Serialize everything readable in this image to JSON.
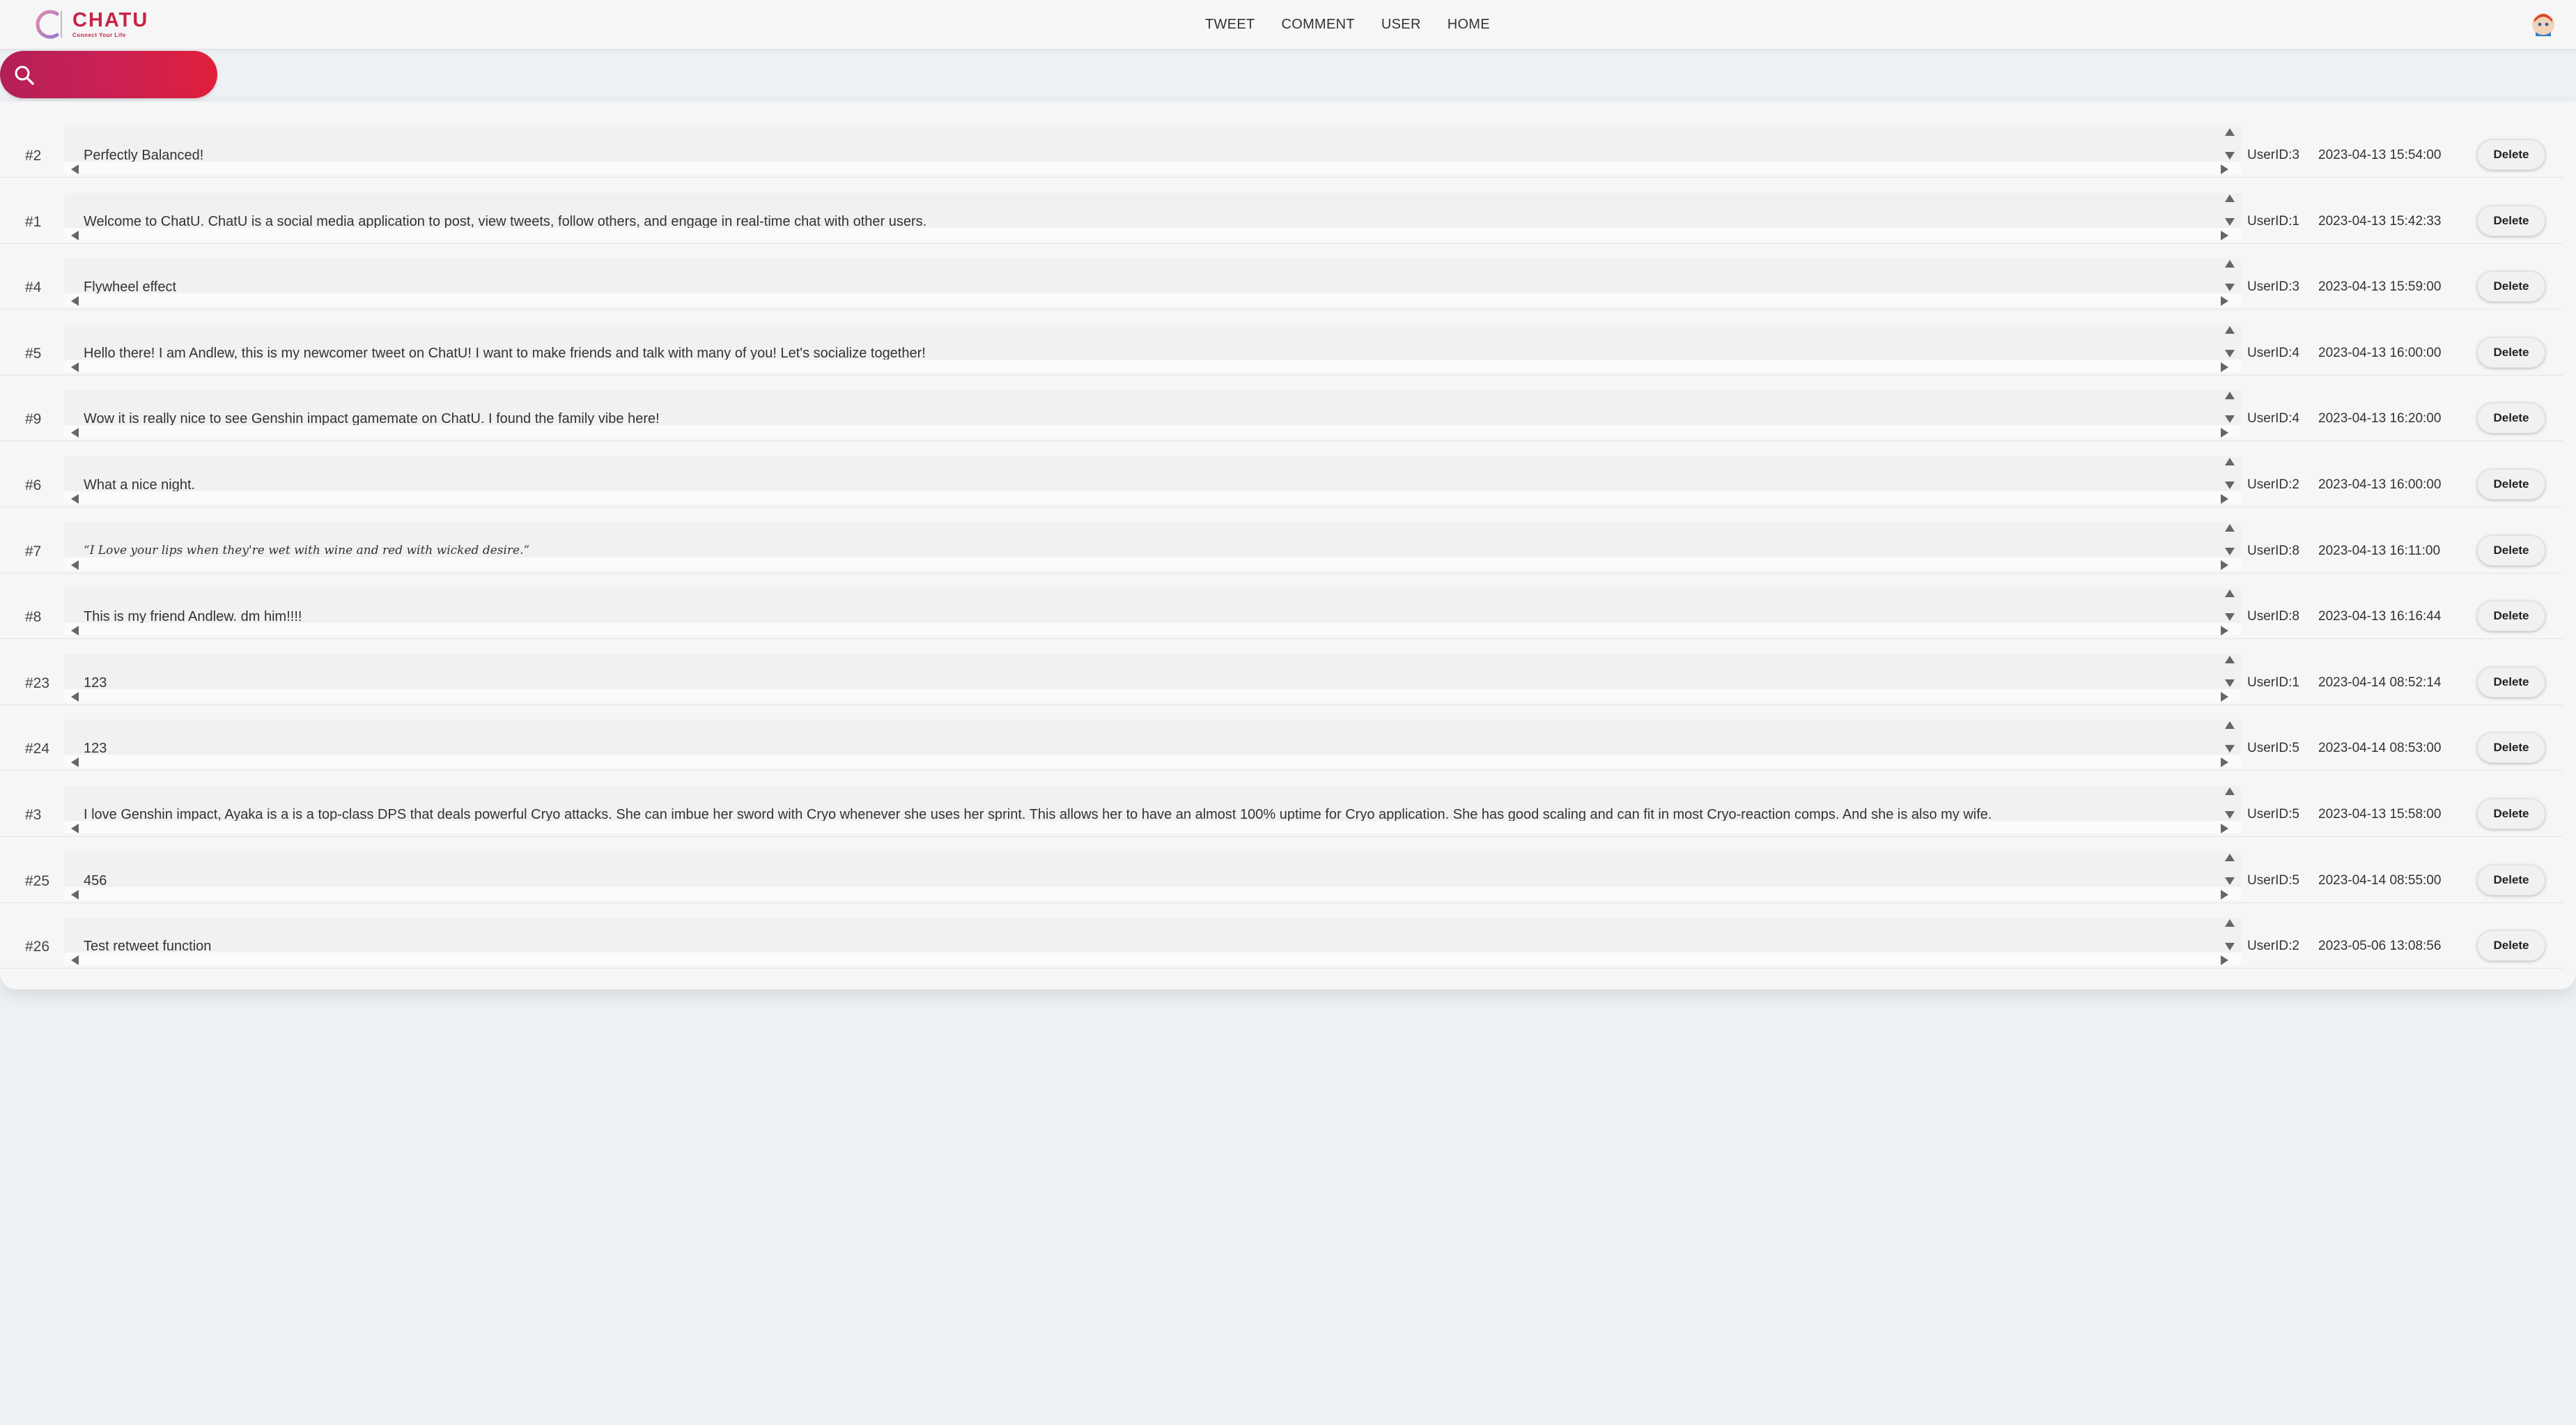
{
  "app": {
    "brand": "CHATU",
    "tagline": "Connect Your Life"
  },
  "nav": {
    "items": [
      {
        "label": "TWEET",
        "name": "nav-tweet"
      },
      {
        "label": "COMMENT",
        "name": "nav-comment"
      },
      {
        "label": "USER",
        "name": "nav-user"
      },
      {
        "label": "HOME",
        "name": "nav-home"
      }
    ]
  },
  "search": {
    "placeholder": "",
    "value": "",
    "icon": "search-icon"
  },
  "colors": {
    "brand": "#c72346",
    "search_gradient_start": "#b31f57",
    "search_gradient_end": "#e01f3a",
    "page_bg": "#eef1f4"
  },
  "tweets": {
    "delete_label": "Delete",
    "rows": [
      {
        "id": "#2",
        "content": "Perfectly Balanced!",
        "user": "UserID:3",
        "time": "2023-04-13 15:54:00",
        "italic": false
      },
      {
        "id": "#1",
        "content": "Welcome to ChatU. ChatU is a social media application to post, view tweets, follow others, and engage in real-time chat with other users.",
        "user": "UserID:1",
        "time": "2023-04-13 15:42:33",
        "italic": false
      },
      {
        "id": "#4",
        "content": "Flywheel effect",
        "user": "UserID:3",
        "time": "2023-04-13 15:59:00",
        "italic": false
      },
      {
        "id": "#5",
        "content": "Hello there! I am Andlew, this is my newcomer tweet on ChatU! I want to make friends and talk with many of you! Let's socialize together!",
        "user": "UserID:4",
        "time": "2023-04-13 16:00:00",
        "italic": false
      },
      {
        "id": "#9",
        "content": "Wow it is really nice to see Genshin impact gamemate on ChatU. I found the family vibe here!",
        "user": "UserID:4",
        "time": "2023-04-13 16:20:00",
        "italic": false
      },
      {
        "id": "#6",
        "content": "What a nice night.",
        "user": "UserID:2",
        "time": "2023-04-13 16:00:00",
        "italic": false
      },
      {
        "id": "#7",
        "content": "“I Love your lips when they're wet with wine and red with wicked desire.”",
        "user": "UserID:8",
        "time": "2023-04-13 16:11:00",
        "italic": true
      },
      {
        "id": "#8",
        "content": "This is my friend Andlew. dm him!!!!",
        "user": "UserID:8",
        "time": "2023-04-13 16:16:44",
        "italic": false
      },
      {
        "id": "#23",
        "content": "123",
        "user": "UserID:1",
        "time": "2023-04-14 08:52:14",
        "italic": false
      },
      {
        "id": "#24",
        "content": "123",
        "user": "UserID:5",
        "time": "2023-04-14 08:53:00",
        "italic": false
      },
      {
        "id": "#3",
        "content": "I love Genshin impact, Ayaka is a is a top-class DPS that deals powerful Cryo attacks. She can imbue her sword with Cryo whenever she uses her sprint. This allows her to have an almost 100% uptime for Cryo application. She has good scaling and can fit in most Cryo-reaction comps. And she is also my wife.",
        "user": "UserID:5",
        "time": "2023-04-13 15:58:00",
        "italic": false
      },
      {
        "id": "#25",
        "content": "456",
        "user": "UserID:5",
        "time": "2023-04-14 08:55:00",
        "italic": false
      },
      {
        "id": "#26",
        "content": "Test retweet function",
        "user": "UserID:2",
        "time": "2023-05-06 13:08:56",
        "italic": false
      }
    ]
  }
}
